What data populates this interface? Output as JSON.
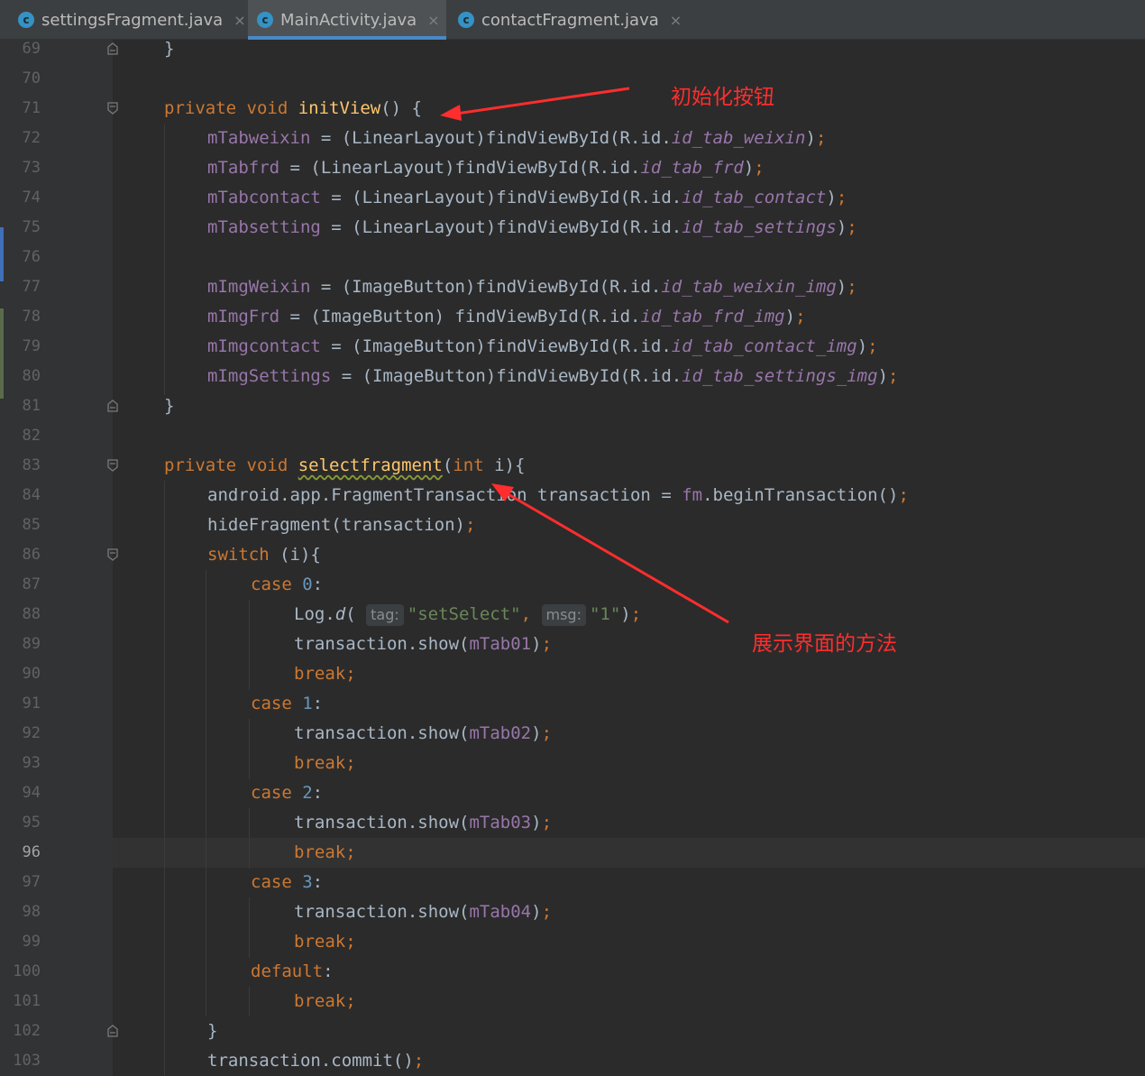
{
  "tabs": [
    {
      "icon": "class-file-icon",
      "label": "settingsFragment.java",
      "active": false
    },
    {
      "icon": "class-file-icon",
      "label": "MainActivity.java",
      "active": true
    },
    {
      "icon": "class-file-icon",
      "label": "contactFragment.java",
      "active": false
    }
  ],
  "class_icon_letter": "c",
  "close_glyph": "×",
  "current_line": "96",
  "line_numbers": [
    "69",
    "70",
    "71",
    "72",
    "73",
    "74",
    "75",
    "76",
    "77",
    "78",
    "79",
    "80",
    "81",
    "82",
    "83",
    "84",
    "85",
    "86",
    "87",
    "88",
    "89",
    "90",
    "91",
    "92",
    "93",
    "94",
    "95",
    "96",
    "97",
    "98",
    "99",
    "100",
    "101",
    "102",
    "103"
  ],
  "code": {
    "l69": {
      "a": "}"
    },
    "l71": {
      "kw": "private void ",
      "fn": "initView",
      "rest": "() {"
    },
    "l72": {
      "field": "mTabweixin",
      "mid": " = (LinearLayout)findViewById(R.id.",
      "id": "id_tab_weixin",
      "end": ")",
      "semi": ";"
    },
    "l73": {
      "field": "mTabfrd",
      "mid": " = (LinearLayout)findViewById(R.id.",
      "id": "id_tab_frd",
      "end": ")",
      "semi": ";"
    },
    "l74": {
      "field": "mTabcontact",
      "mid": " = (LinearLayout)findViewById(R.id.",
      "id": "id_tab_contact",
      "end": ")",
      "semi": ";"
    },
    "l75": {
      "field": "mTabsetting",
      "mid": " = (LinearLayout)findViewById(R.id.",
      "id": "id_tab_settings",
      "end": ")",
      "semi": ";"
    },
    "l77": {
      "field": "mImgWeixin",
      "mid": " = (ImageButton)findViewById(R.id.",
      "id": "id_tab_weixin_img",
      "end": ")",
      "semi": ";"
    },
    "l78": {
      "field": "mImgFrd",
      "mid": " = (ImageButton) findViewById(R.id.",
      "id": "id_tab_frd_img",
      "end": ")",
      "semi": ";"
    },
    "l79": {
      "field": "mImgcontact",
      "mid": " = (ImageButton)findViewById(R.id.",
      "id": "id_tab_contact_img",
      "end": ")",
      "semi": ";"
    },
    "l80": {
      "field": "mImgSettings",
      "mid": " = (ImageButton)findViewById(R.id.",
      "id": "id_tab_settings_img",
      "end": ")",
      "semi": ";"
    },
    "l81": {
      "a": "}"
    },
    "l83": {
      "kw": "private void ",
      "fn": "selectfragment",
      "p1": "(",
      "kw2": "int",
      "p2": " i){"
    },
    "l84": {
      "a": "android.app.FragmentTransaction transaction = ",
      "field": "fm",
      "b": ".beginTransaction()",
      "semi": ";"
    },
    "l85": {
      "a": "hideFragment(transaction)",
      "semi": ";"
    },
    "l86": {
      "kw": "switch",
      "a": " (i){"
    },
    "l87": {
      "kw": "case ",
      "num": "0",
      "a": ":"
    },
    "l88": {
      "a": "Log.",
      "m": "d",
      "b": "(",
      "hint1": "tag:",
      "str1": "\"setSelect\"",
      "comma": ",",
      "hint2": "msg:",
      "str2": "\"1\"",
      "c": ")",
      "semi": ";"
    },
    "l89": {
      "a": "transaction.show(",
      "field": "mTab01",
      "b": ")",
      "semi": ";"
    },
    "l90": {
      "kw": "break;"
    },
    "l91": {
      "kw": "case ",
      "num": "1",
      "a": ":"
    },
    "l92": {
      "a": "transaction.show(",
      "field": "mTab02",
      "b": ")",
      "semi": ";"
    },
    "l93": {
      "kw": "break;"
    },
    "l94": {
      "kw": "case ",
      "num": "2",
      "a": ":"
    },
    "l95": {
      "a": "transaction.show(",
      "field": "mTab03",
      "b": ")",
      "semi": ";"
    },
    "l96": {
      "kw": "break;"
    },
    "l97": {
      "kw": "case ",
      "num": "3",
      "a": ":"
    },
    "l98": {
      "a": "transaction.show(",
      "field": "mTab04",
      "b": ")",
      "semi": ";"
    },
    "l99": {
      "kw": "break;"
    },
    "l100": {
      "kw": "default",
      "a": ":"
    },
    "l101": {
      "kw": "break;"
    },
    "l102": {
      "a": "}"
    },
    "l103": {
      "a": "transaction.commit()",
      "semi": ";"
    }
  },
  "annotations": {
    "init_buttons": "初始化按钮",
    "show_method": "展示界面的方法"
  },
  "colors": {
    "background": "#2b2b2b",
    "keyword": "#cc7832",
    "method": "#ffc66d",
    "field": "#9876aa",
    "number": "#6897bb",
    "string": "#6a8759",
    "annotation": "#ff2d2d"
  }
}
